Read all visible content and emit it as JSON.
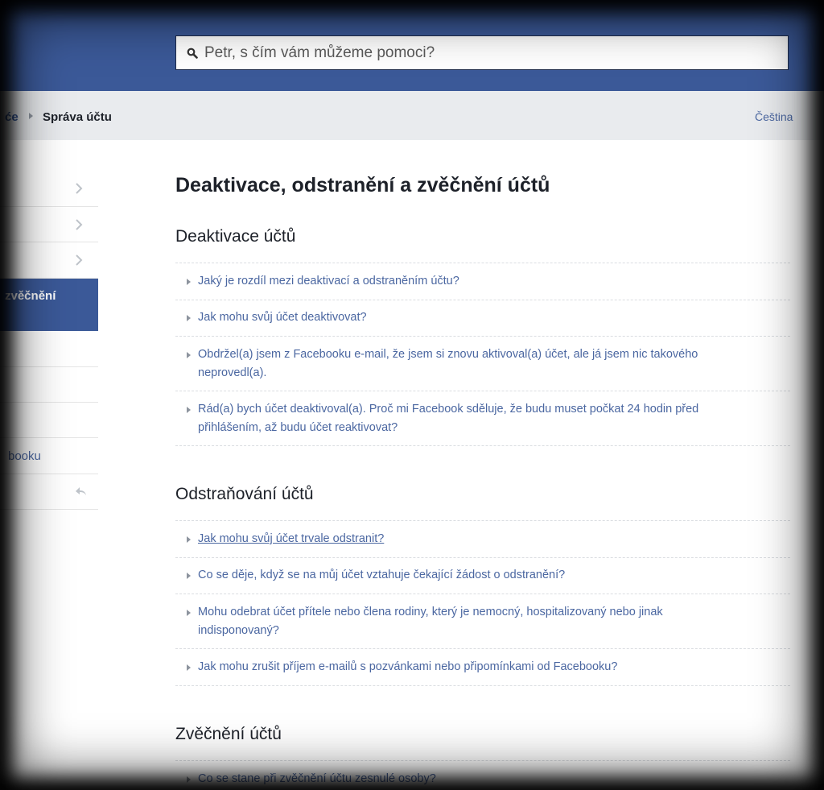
{
  "search": {
    "placeholder": "Petr, s čím vám můžeme pomoci?"
  },
  "breadcrumb": {
    "previous": "će",
    "current": "Správa účtu",
    "language": "Čeština"
  },
  "sidebar": {
    "active_label": "zvěčnění",
    "facebook_link": "booku"
  },
  "main": {
    "title": "Deaktivace, odstranění a zvěčnění účtů",
    "sections": [
      {
        "title": "Deaktivace účtů",
        "questions": [
          "Jaký je rozdíl mezi deaktivací a odstraněním účtu?",
          "Jak mohu svůj účet deaktivovat?",
          "Obdržel(a) jsem z Facebooku e-mail, že jsem si znovu aktivoval(a) účet, ale já jsem nic takového neprovedl(a).",
          "Rád(a) bych účet deaktivoval(a). Proč mi Facebook sděluje, že budu muset počkat 24 hodin před přihlášením, až budu účet reaktivovat?"
        ]
      },
      {
        "title": "Odstraňování účtů",
        "questions": [
          "Jak mohu svůj účet trvale odstranit?",
          "Co se děje, když se na můj účet vztahuje čekající žádost o odstranění?",
          "Mohu odebrat účet přítele nebo člena rodiny, který je nemocný, hospitalizovaný nebo jinak indisponovaný?",
          "Jak mohu zrušit příjem e-mailů s pozvánkami nebo připomínkami od Facebooku?"
        ]
      },
      {
        "title": "Zvěčnění účtů",
        "questions": [
          "Co se stane při zvěčnění účtu zesnulé osoby?"
        ]
      }
    ]
  },
  "colors": {
    "brand": "#3b5998",
    "link": "#4b67a1",
    "breadcrumb_bg": "#e9ebee"
  }
}
